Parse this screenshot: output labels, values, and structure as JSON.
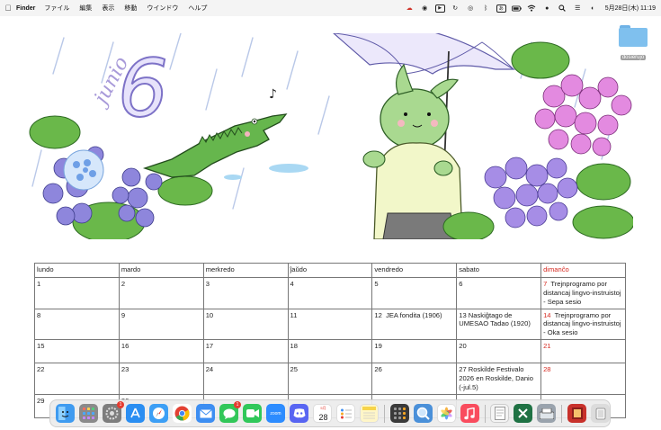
{
  "menubar": {
    "app_name": "Finder",
    "menus": [
      "ファイル",
      "編集",
      "表示",
      "移動",
      "ウインドウ",
      "ヘルプ"
    ],
    "datetime": "5月28日(木)  11:19"
  },
  "desktop": {
    "folder_label": "dosierujo",
    "wallpaper": {
      "month_text": "junio",
      "day_numeral": "6",
      "music_note": "♪"
    }
  },
  "calendar": {
    "headers": [
      "lundo",
      "mardo",
      "merkredo",
      "ĵaŭdo",
      "vendredo",
      "sabato",
      "dimanĉo"
    ],
    "weeks": [
      [
        "1",
        "2",
        "3",
        "4",
        "5",
        "6",
        "7"
      ],
      [
        "8",
        "9",
        "10",
        "11",
        "12",
        "13",
        "14"
      ],
      [
        "15",
        "16",
        "17",
        "18",
        "19",
        "20",
        "21"
      ],
      [
        "22",
        "23",
        "24",
        "25",
        "26",
        "27",
        "28"
      ],
      [
        "29",
        "30",
        "",
        "",
        "",
        "",
        ""
      ]
    ],
    "events": {
      "w0_d6": "Trejnprogramo por distancaj lingvo-instruistoj - Sepa sesio",
      "w1_d4": "JEA fondita (1906)",
      "w1_d5": "Naskiĝtago de UMESAO Tadao (1920)",
      "w1_d6": "Trejnprogramo por distancaj lingvo-instruistoj - Oka sesio",
      "w3_d5": "Roskilde Festivalo 2026 en Roskilde, Danio (-jul.5)"
    },
    "sunday_color": "#d62b22"
  },
  "dock": {
    "calendar_month": "5月",
    "calendar_day": "28",
    "badges": {
      "settings": "1",
      "messages": "1"
    },
    "items": [
      {
        "name": "finder-icon",
        "color": "#3f9bf0"
      },
      {
        "name": "launchpad-icon",
        "color": "#8a8a8a"
      },
      {
        "name": "system-settings-icon",
        "color": "#7d7d7d"
      },
      {
        "name": "app-store-icon",
        "color": "#2a8ef2"
      },
      {
        "name": "safari-icon",
        "color": "#3d9ff5"
      },
      {
        "name": "chrome-icon",
        "color": "#ffffff"
      },
      {
        "name": "mail-icon",
        "color": "#3d8ef2"
      },
      {
        "name": "messages-icon",
        "color": "#32c759"
      },
      {
        "name": "facetime-icon",
        "color": "#30c85a"
      },
      {
        "name": "zoom-icon",
        "color": "#2d8cff"
      },
      {
        "name": "discord-icon",
        "color": "#5865f2"
      },
      {
        "name": "calendar-icon",
        "color": "#ffffff"
      },
      {
        "name": "reminders-icon",
        "color": "#ffffff"
      },
      {
        "name": "notes-icon",
        "color": "#fff6c8"
      },
      {
        "name": "calculator-icon",
        "color": "#3a3a3a"
      },
      {
        "name": "preview-icon",
        "color": "#4a90d9"
      },
      {
        "name": "photos-icon",
        "color": "#ffffff"
      },
      {
        "name": "music-icon",
        "color": "#f94c5e"
      },
      {
        "name": "textedit-icon",
        "color": "#f4f4f4"
      },
      {
        "name": "excel-icon",
        "color": "#1f7244"
      },
      {
        "name": "scanner-icon",
        "color": "#9aa3ad"
      },
      {
        "name": "photo-booth-icon",
        "color": "#c8312b"
      },
      {
        "name": "trash-icon",
        "color": "#dcdcdc"
      }
    ]
  }
}
